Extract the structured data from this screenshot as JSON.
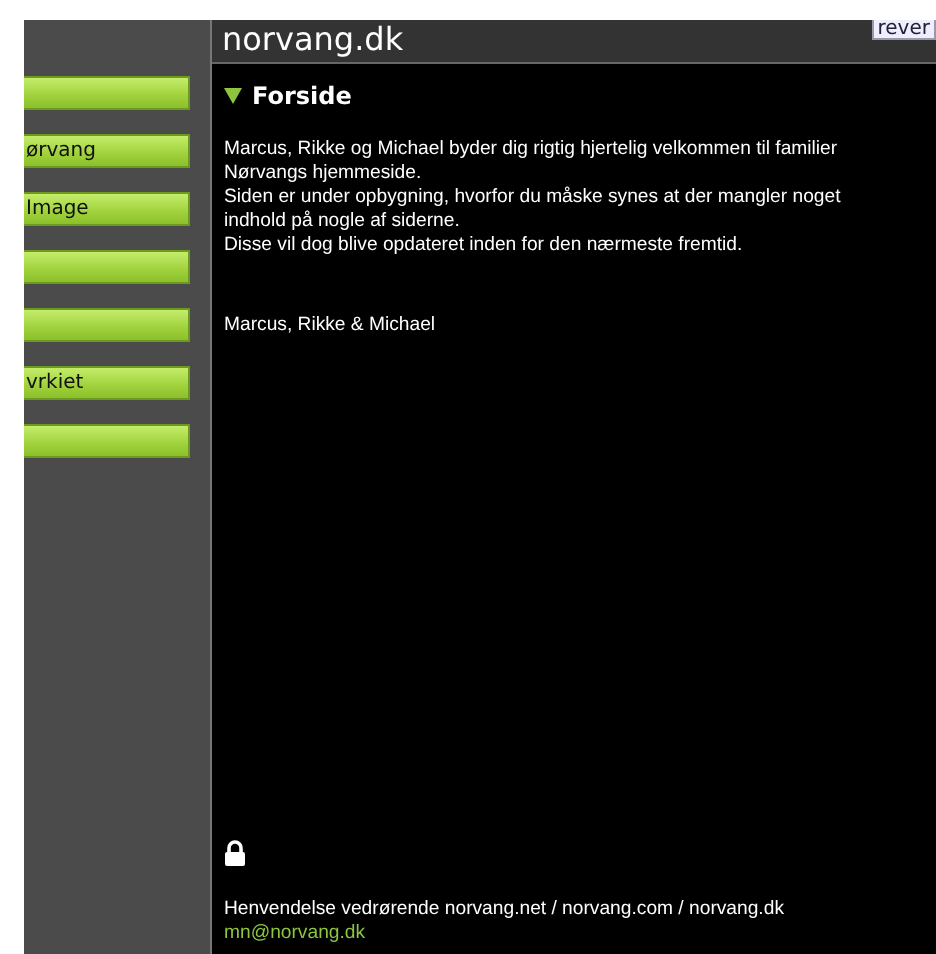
{
  "header": {
    "title": "norvang.dk",
    "button": "rever"
  },
  "sidebar": {
    "items": [
      {
        "kind": "blank"
      },
      {
        "kind": "labeled",
        "label": "ørvang"
      },
      {
        "kind": "labeled",
        "label": "Image"
      },
      {
        "kind": "blank"
      },
      {
        "kind": "blank"
      },
      {
        "kind": "labeled",
        "label": "vrkiet"
      },
      {
        "kind": "blank"
      }
    ]
  },
  "content": {
    "heading": "Forside",
    "expanded": true,
    "lines": [
      "Marcus, Rikke og Michael byder dig rigtig hjertelig velkommen til familier",
      "Nørvangs hjemmeside.",
      "Siden er under opbygning, hvorfor du måske synes at der mangler noget",
      "indhold på nogle af siderne.",
      "Disse vil dog blive opdateret inden for den nærmeste fremtid."
    ],
    "signature": "Marcus, Rikke & Michael"
  },
  "footer": {
    "text": "Henvendelse vedrørende norvang.net / norvang.com / norvang.dk",
    "email": "mn@norvang.dk"
  }
}
